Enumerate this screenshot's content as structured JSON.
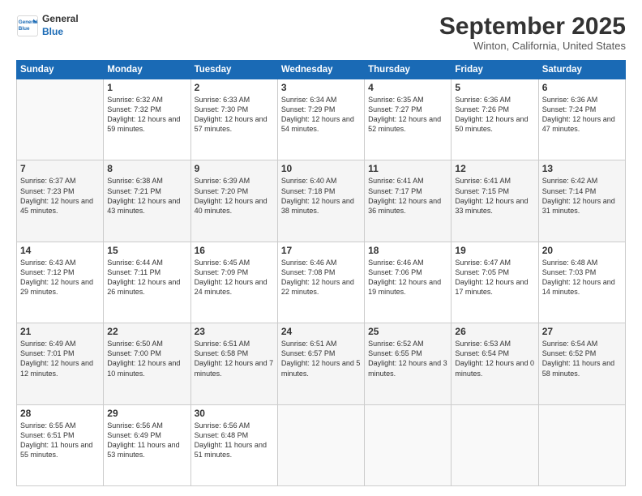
{
  "logo": {
    "line1": "General",
    "line2": "Blue"
  },
  "header": {
    "month": "September 2025",
    "location": "Winton, California, United States"
  },
  "weekdays": [
    "Sunday",
    "Monday",
    "Tuesday",
    "Wednesday",
    "Thursday",
    "Friday",
    "Saturday"
  ],
  "weeks": [
    [
      {
        "day": "",
        "sunrise": "",
        "sunset": "",
        "daylight": ""
      },
      {
        "day": "1",
        "sunrise": "Sunrise: 6:32 AM",
        "sunset": "Sunset: 7:32 PM",
        "daylight": "Daylight: 12 hours and 59 minutes."
      },
      {
        "day": "2",
        "sunrise": "Sunrise: 6:33 AM",
        "sunset": "Sunset: 7:30 PM",
        "daylight": "Daylight: 12 hours and 57 minutes."
      },
      {
        "day": "3",
        "sunrise": "Sunrise: 6:34 AM",
        "sunset": "Sunset: 7:29 PM",
        "daylight": "Daylight: 12 hours and 54 minutes."
      },
      {
        "day": "4",
        "sunrise": "Sunrise: 6:35 AM",
        "sunset": "Sunset: 7:27 PM",
        "daylight": "Daylight: 12 hours and 52 minutes."
      },
      {
        "day": "5",
        "sunrise": "Sunrise: 6:36 AM",
        "sunset": "Sunset: 7:26 PM",
        "daylight": "Daylight: 12 hours and 50 minutes."
      },
      {
        "day": "6",
        "sunrise": "Sunrise: 6:36 AM",
        "sunset": "Sunset: 7:24 PM",
        "daylight": "Daylight: 12 hours and 47 minutes."
      }
    ],
    [
      {
        "day": "7",
        "sunrise": "Sunrise: 6:37 AM",
        "sunset": "Sunset: 7:23 PM",
        "daylight": "Daylight: 12 hours and 45 minutes."
      },
      {
        "day": "8",
        "sunrise": "Sunrise: 6:38 AM",
        "sunset": "Sunset: 7:21 PM",
        "daylight": "Daylight: 12 hours and 43 minutes."
      },
      {
        "day": "9",
        "sunrise": "Sunrise: 6:39 AM",
        "sunset": "Sunset: 7:20 PM",
        "daylight": "Daylight: 12 hours and 40 minutes."
      },
      {
        "day": "10",
        "sunrise": "Sunrise: 6:40 AM",
        "sunset": "Sunset: 7:18 PM",
        "daylight": "Daylight: 12 hours and 38 minutes."
      },
      {
        "day": "11",
        "sunrise": "Sunrise: 6:41 AM",
        "sunset": "Sunset: 7:17 PM",
        "daylight": "Daylight: 12 hours and 36 minutes."
      },
      {
        "day": "12",
        "sunrise": "Sunrise: 6:41 AM",
        "sunset": "Sunset: 7:15 PM",
        "daylight": "Daylight: 12 hours and 33 minutes."
      },
      {
        "day": "13",
        "sunrise": "Sunrise: 6:42 AM",
        "sunset": "Sunset: 7:14 PM",
        "daylight": "Daylight: 12 hours and 31 minutes."
      }
    ],
    [
      {
        "day": "14",
        "sunrise": "Sunrise: 6:43 AM",
        "sunset": "Sunset: 7:12 PM",
        "daylight": "Daylight: 12 hours and 29 minutes."
      },
      {
        "day": "15",
        "sunrise": "Sunrise: 6:44 AM",
        "sunset": "Sunset: 7:11 PM",
        "daylight": "Daylight: 12 hours and 26 minutes."
      },
      {
        "day": "16",
        "sunrise": "Sunrise: 6:45 AM",
        "sunset": "Sunset: 7:09 PM",
        "daylight": "Daylight: 12 hours and 24 minutes."
      },
      {
        "day": "17",
        "sunrise": "Sunrise: 6:46 AM",
        "sunset": "Sunset: 7:08 PM",
        "daylight": "Daylight: 12 hours and 22 minutes."
      },
      {
        "day": "18",
        "sunrise": "Sunrise: 6:46 AM",
        "sunset": "Sunset: 7:06 PM",
        "daylight": "Daylight: 12 hours and 19 minutes."
      },
      {
        "day": "19",
        "sunrise": "Sunrise: 6:47 AM",
        "sunset": "Sunset: 7:05 PM",
        "daylight": "Daylight: 12 hours and 17 minutes."
      },
      {
        "day": "20",
        "sunrise": "Sunrise: 6:48 AM",
        "sunset": "Sunset: 7:03 PM",
        "daylight": "Daylight: 12 hours and 14 minutes."
      }
    ],
    [
      {
        "day": "21",
        "sunrise": "Sunrise: 6:49 AM",
        "sunset": "Sunset: 7:01 PM",
        "daylight": "Daylight: 12 hours and 12 minutes."
      },
      {
        "day": "22",
        "sunrise": "Sunrise: 6:50 AM",
        "sunset": "Sunset: 7:00 PM",
        "daylight": "Daylight: 12 hours and 10 minutes."
      },
      {
        "day": "23",
        "sunrise": "Sunrise: 6:51 AM",
        "sunset": "Sunset: 6:58 PM",
        "daylight": "Daylight: 12 hours and 7 minutes."
      },
      {
        "day": "24",
        "sunrise": "Sunrise: 6:51 AM",
        "sunset": "Sunset: 6:57 PM",
        "daylight": "Daylight: 12 hours and 5 minutes."
      },
      {
        "day": "25",
        "sunrise": "Sunrise: 6:52 AM",
        "sunset": "Sunset: 6:55 PM",
        "daylight": "Daylight: 12 hours and 3 minutes."
      },
      {
        "day": "26",
        "sunrise": "Sunrise: 6:53 AM",
        "sunset": "Sunset: 6:54 PM",
        "daylight": "Daylight: 12 hours and 0 minutes."
      },
      {
        "day": "27",
        "sunrise": "Sunrise: 6:54 AM",
        "sunset": "Sunset: 6:52 PM",
        "daylight": "Daylight: 11 hours and 58 minutes."
      }
    ],
    [
      {
        "day": "28",
        "sunrise": "Sunrise: 6:55 AM",
        "sunset": "Sunset: 6:51 PM",
        "daylight": "Daylight: 11 hours and 55 minutes."
      },
      {
        "day": "29",
        "sunrise": "Sunrise: 6:56 AM",
        "sunset": "Sunset: 6:49 PM",
        "daylight": "Daylight: 11 hours and 53 minutes."
      },
      {
        "day": "30",
        "sunrise": "Sunrise: 6:56 AM",
        "sunset": "Sunset: 6:48 PM",
        "daylight": "Daylight: 11 hours and 51 minutes."
      },
      {
        "day": "",
        "sunrise": "",
        "sunset": "",
        "daylight": ""
      },
      {
        "day": "",
        "sunrise": "",
        "sunset": "",
        "daylight": ""
      },
      {
        "day": "",
        "sunrise": "",
        "sunset": "",
        "daylight": ""
      },
      {
        "day": "",
        "sunrise": "",
        "sunset": "",
        "daylight": ""
      }
    ]
  ]
}
